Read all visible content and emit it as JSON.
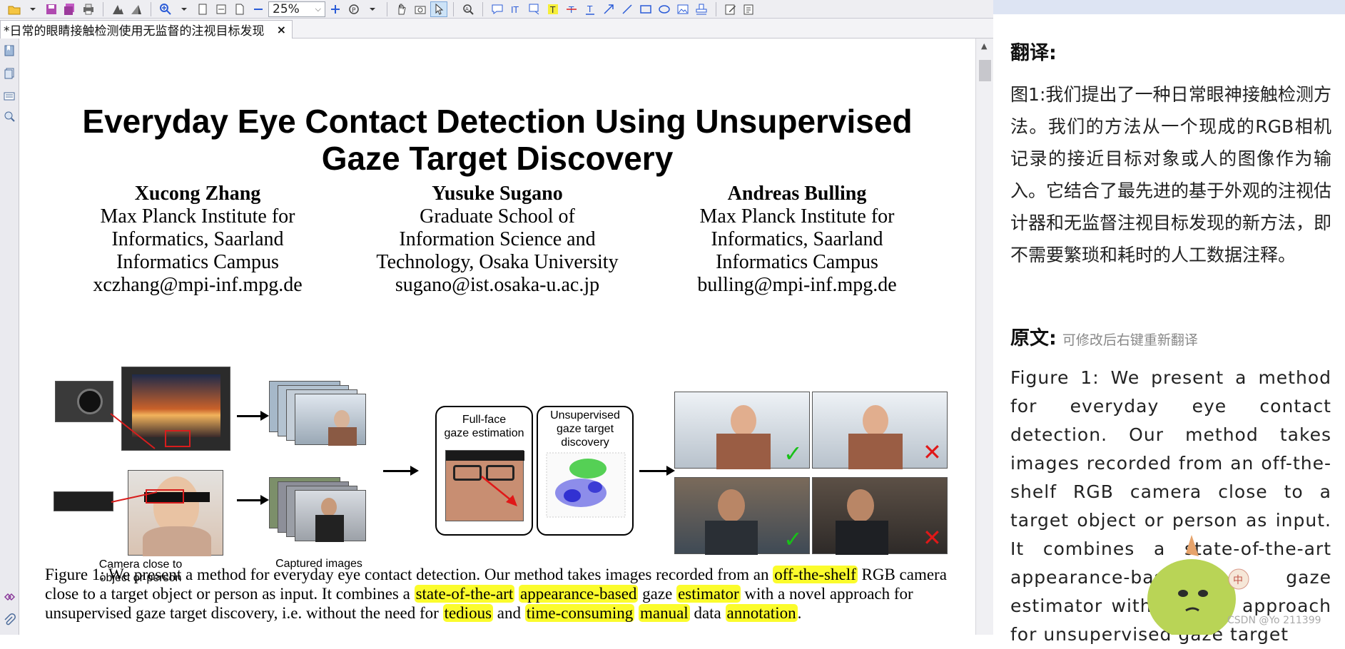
{
  "toolbar": {
    "zoom_value": "25%",
    "icons": [
      "open-icon",
      "save-icon",
      "save-all-icon",
      "print-icon",
      "mountain-icon",
      "mountain-alt-icon",
      "zoom-in-icon",
      "fit-page-icon",
      "fit-width-icon",
      "fit-visible-icon",
      "minus-icon",
      "plus-icon",
      "pan-icon",
      "hand-icon",
      "snapshot-icon",
      "select-icon",
      "search-icon",
      "comment-icon",
      "text-box-icon",
      "highlight-icon",
      "underline-icon",
      "strikeout-icon",
      "text-icon",
      "arrow-icon",
      "line-icon",
      "rectangle-icon",
      "ellipse-icon",
      "stamp-icon",
      "sign-icon",
      "edit-icon",
      "edit-alt-icon"
    ]
  },
  "tab": {
    "title": "*日常的眼睛接触检测使用无监督的注视目标发现",
    "close": "×"
  },
  "paper": {
    "title_line1": "Everyday Eye Contact Detection Using Unsupervised",
    "title_line2": "Gaze Target Discovery",
    "authors": [
      {
        "name": "Xucong Zhang",
        "aff1": "Max Planck Institute for",
        "aff2": "Informatics, Saarland",
        "aff3": "Informatics Campus",
        "email": "xczhang@mpi-inf.mpg.de"
      },
      {
        "name": "Yusuke Sugano",
        "aff1": "Graduate School of",
        "aff2": "Information Science and",
        "aff3": "Technology, Osaka University",
        "email": "sugano@ist.osaka-u.ac.jp"
      },
      {
        "name": "Andreas Bulling",
        "aff1": "Max Planck Institute for",
        "aff2": "Informatics, Saarland",
        "aff3": "Informatics Campus",
        "email": "bulling@mpi-inf.mpg.de"
      }
    ],
    "figure": {
      "label_camera_1": "Camera close to",
      "label_camera_2": "object or person",
      "label_captured": "Captured images",
      "label_fullface_1": "Full-face",
      "label_fullface_2": "gaze estimation",
      "label_unsup_1": "Unsupervised",
      "label_unsup_2": "gaze target",
      "label_unsup_3": "discovery"
    },
    "caption": {
      "p1": "Figure 1: We present a method for everyday eye contact detection. Our method takes images recorded from an ",
      "h1": "off-the-shelf",
      "p2": " RGB camera close to a target object or person as input. It combines a ",
      "h2": "state-of-the-art",
      "p3": " ",
      "h3": "appearance-based",
      "p4": " gaze ",
      "h4": "estimator",
      "p5": " with a novel approach for unsupervised gaze target discovery, i.e. without the need for ",
      "h5": "tedious",
      "p6": " and ",
      "h6": "time-consuming",
      "p7": " ",
      "h7": "manual",
      "p8": " data ",
      "h8": "annotation",
      "p9": "."
    }
  },
  "panel": {
    "translation_heading": "翻译:",
    "translation_text": "图1:我们提出了一种日常眼神接触检测方法。我们的方法从一个现成的RGB相机记录的接近目标对象或人的图像作为输入。它结合了最先进的基于外观的注视估计器和无监督注视目标发现的新方法，即不需要繁琐和耗时的人工数据注释。",
    "original_heading": "原文:",
    "original_hint": "可修改后右键重新翻译",
    "original_text": "Figure 1: We present a method for everyday eye contact detection. Our method takes images recorded from an off-the-shelf RGB camera close to a target object or person as input. It combines a state-of-the-art appearance-based gaze estimator with a novel approach for unsupervised gaze target",
    "watermark": "CSDN @Yo 211399",
    "mascot_badge": "中"
  }
}
